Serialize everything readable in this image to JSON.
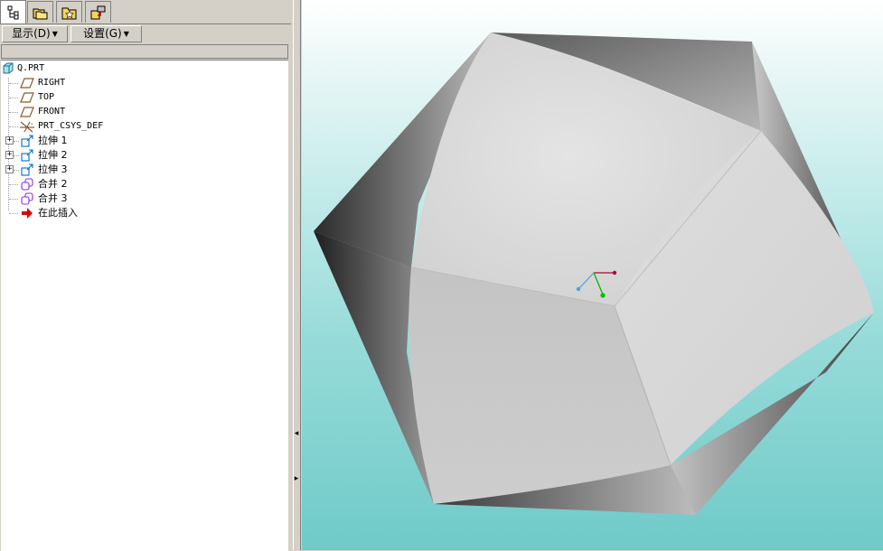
{
  "tabs": [
    {
      "name": "model-tree-tab-icon"
    },
    {
      "name": "folder-browser-tab-icon"
    },
    {
      "name": "favorites-tab-icon"
    },
    {
      "name": "connections-tab-icon"
    }
  ],
  "menus": {
    "show": "显示(D)",
    "settings": "设置(G)"
  },
  "tree": {
    "root": "Q.PRT",
    "items": [
      {
        "label": "RIGHT",
        "icon": "datum-plane-icon"
      },
      {
        "label": "TOP",
        "icon": "datum-plane-icon"
      },
      {
        "label": "FRONT",
        "icon": "datum-plane-icon"
      },
      {
        "label": "PRT_CSYS_DEF",
        "icon": "coordinate-system-icon"
      },
      {
        "label": "拉伸 1",
        "icon": "extrude-icon"
      },
      {
        "label": "拉伸 2",
        "icon": "extrude-icon"
      },
      {
        "label": "拉伸 3",
        "icon": "extrude-icon"
      },
      {
        "label": "合并 2",
        "icon": "merge-icon"
      },
      {
        "label": "合并 3",
        "icon": "merge-icon"
      },
      {
        "label": "在此插入",
        "icon": "insert-here-arrow-icon"
      }
    ]
  },
  "colors": {
    "panel": "#d4d0c8",
    "viewport_top": "#ffffff",
    "viewport_bottom": "#6fcac8",
    "datum_plane": "#8b5a2b",
    "feature_icon": "#0070c0",
    "merge_icon": "#8a2be2",
    "insert_arrow": "#e00000"
  }
}
